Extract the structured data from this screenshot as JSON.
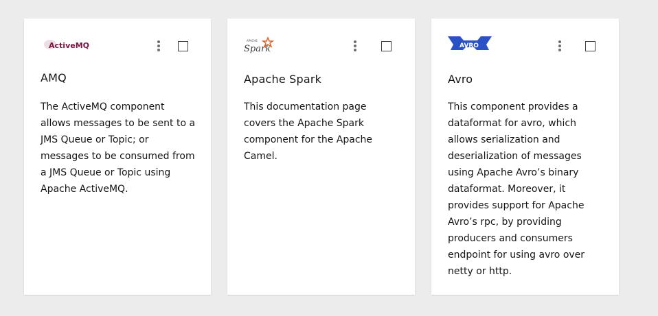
{
  "cards": [
    {
      "logo_text": "ActiveMQ",
      "title": "AMQ",
      "description": "The ActiveMQ component allows messages to be sent to a JMS Queue or Topic; or messages to be consumed from a JMS Queue or Topic using Apache ActiveMQ."
    },
    {
      "logo_text": "Spark",
      "logo_subtext": "APACHE",
      "title": "Apache Spark",
      "description": "This documentation page covers the Apache Spark component for the Apache Camel."
    },
    {
      "logo_text": "AVRO",
      "title": "Avro",
      "description": "This component provides a dataformat for avro, which allows serialization and deserialization of messages using Apache Avro’s binary dataformat. Moreover, it provides support for Apache Avro’s rpc, by providing producers and consumers endpoint for using avro over netty or http."
    }
  ],
  "colors": {
    "background": "#ececec",
    "card": "#ffffff",
    "text": "#151515",
    "kebab": "#6a6e73",
    "activemq_logo": "#7a1540",
    "spark_orange": "#e25a1c",
    "avro_blue": "#2b51c6"
  },
  "icons": {
    "menu": "kebab-vertical-icon",
    "select": "checkbox"
  }
}
